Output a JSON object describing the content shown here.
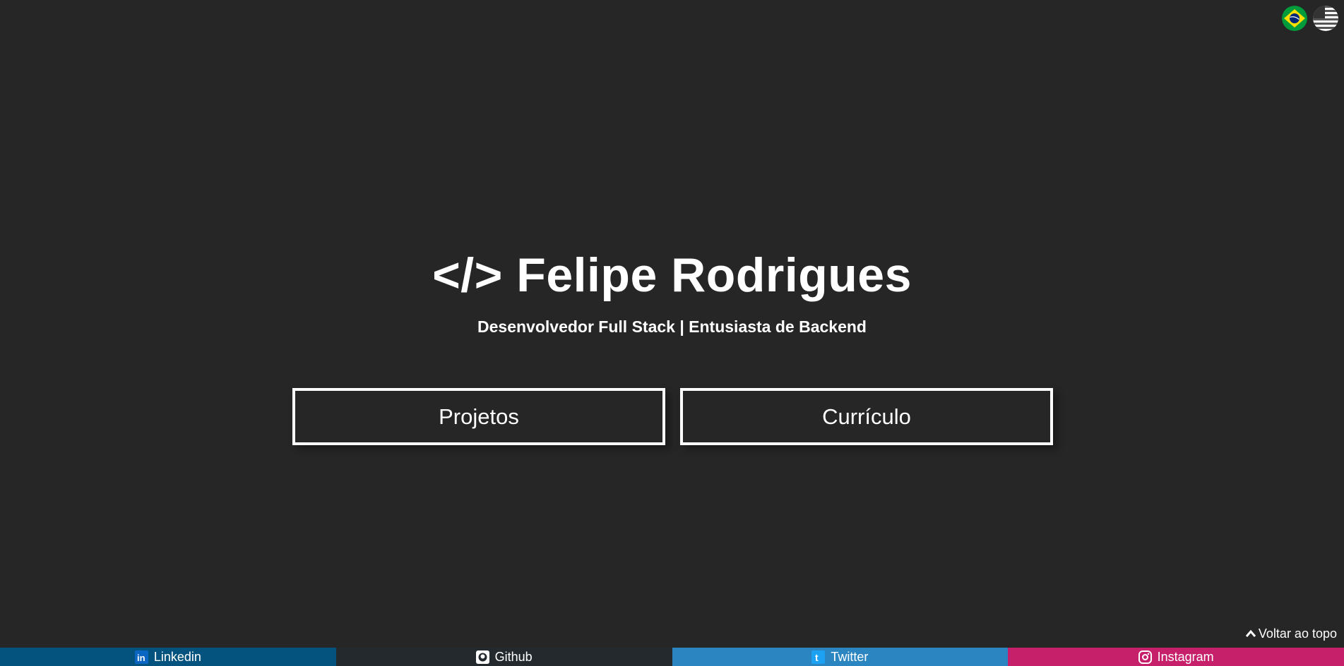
{
  "hero": {
    "title": "</> Felipe Rodrigues",
    "subtitle": "Desenvolvedor Full Stack | Entusiasta de Backend"
  },
  "buttons": {
    "projects": "Projetos",
    "resume": "Currículo"
  },
  "languages": [
    {
      "name": "brazil-flag-icon"
    },
    {
      "name": "usa-flag-icon"
    }
  ],
  "back_to_top": "Voltar ao topo",
  "social": [
    {
      "label": "Linkedin",
      "icon": "linkedin-icon",
      "color": "#03537e"
    },
    {
      "label": "Github",
      "icon": "github-icon",
      "color": "#24292e"
    },
    {
      "label": "Twitter",
      "icon": "twitter-icon",
      "color": "#2b85c1"
    },
    {
      "label": "Instagram",
      "icon": "instagram-icon",
      "color": "#c6206b"
    }
  ],
  "colors": {
    "background": "#262626",
    "text": "#ffffff"
  }
}
